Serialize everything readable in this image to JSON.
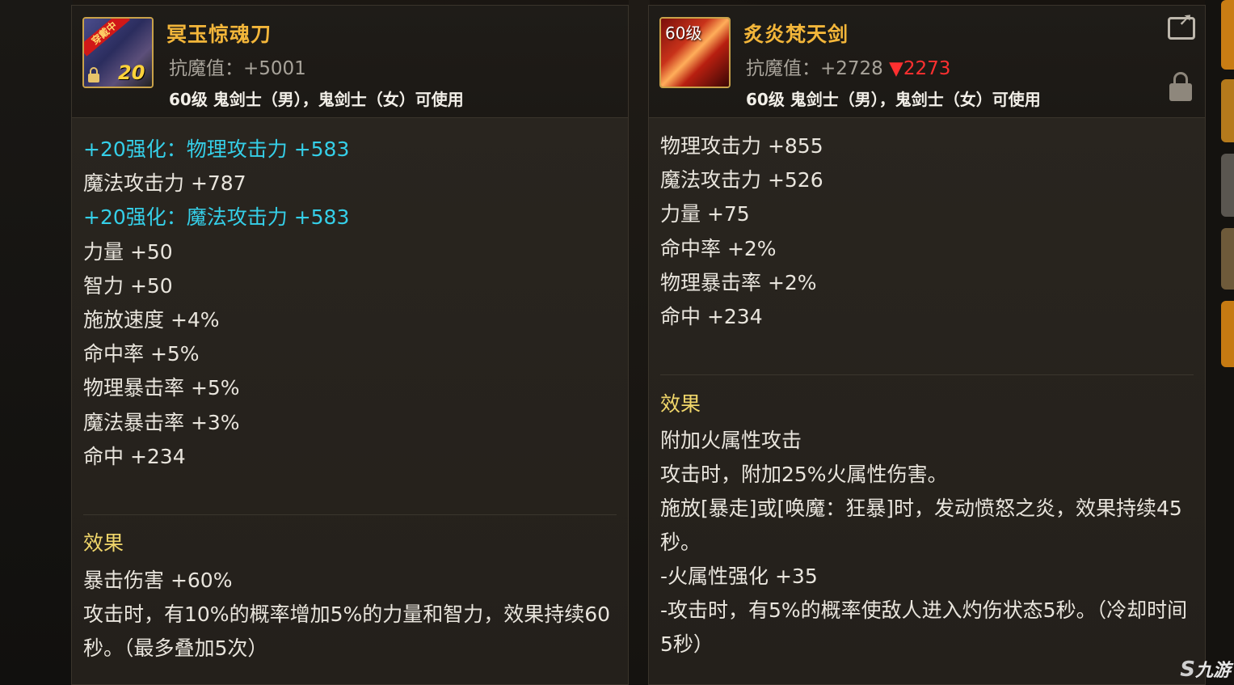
{
  "left_item": {
    "icon_badge": "穿戴中",
    "icon_plus": "20",
    "name": "冥玉惊魂刀",
    "resist": "抗魔值：+5001",
    "usable": "60级 鬼剑士（男），鬼剑士（女）可使用",
    "stats": [
      {
        "text": "+20强化：物理攻击力 +583",
        "enhanced": true
      },
      {
        "text": "魔法攻击力 +787",
        "enhanced": false
      },
      {
        "text": "+20强化：魔法攻击力 +583",
        "enhanced": true
      },
      {
        "text": "力量 +50",
        "enhanced": false
      },
      {
        "text": "智力 +50",
        "enhanced": false
      },
      {
        "text": "施放速度 +4%",
        "enhanced": false
      },
      {
        "text": "命中率 +5%",
        "enhanced": false
      },
      {
        "text": "物理暴击率 +5%",
        "enhanced": false
      },
      {
        "text": "魔法暴击率 +3%",
        "enhanced": false
      },
      {
        "text": "命中 +234",
        "enhanced": false
      }
    ],
    "effect_title": "效果",
    "effects": [
      "暴击伤害 +60%",
      "攻击时，有10%的概率增加5%的力量和智力，效果持续60秒。（最多叠加5次）"
    ]
  },
  "right_item": {
    "icon_level": "60级",
    "name": "炙炎梵天剑",
    "resist": "抗魔值：+2728",
    "resist_diff": "▼2273",
    "usable": "60级 鬼剑士（男），鬼剑士（女）可使用",
    "stats": [
      {
        "text": "物理攻击力 +855",
        "enhanced": false
      },
      {
        "text": "魔法攻击力 +526",
        "enhanced": false
      },
      {
        "text": "力量 +75",
        "enhanced": false
      },
      {
        "text": "命中率 +2%",
        "enhanced": false
      },
      {
        "text": "物理暴击率 +2%",
        "enhanced": false
      },
      {
        "text": "命中 +234",
        "enhanced": false
      }
    ],
    "effect_title": "效果",
    "effects": [
      "附加火属性攻击",
      "攻击时，附加25%火属性伤害。",
      "施放[暴走]或[唤魔：狂暴]时，发动愤怒之炎，效果持续45秒。",
      "-火属性强化 +35",
      "-攻击时，有5%的概率使敌人进入灼伤状态5秒。（冷却时间5秒）"
    ]
  },
  "watermark": "九游",
  "colors": {
    "name": "#f3b63a",
    "enhanced": "#35cfe8",
    "effect_title": "#f0d66a",
    "decrease": "#ff3030"
  }
}
